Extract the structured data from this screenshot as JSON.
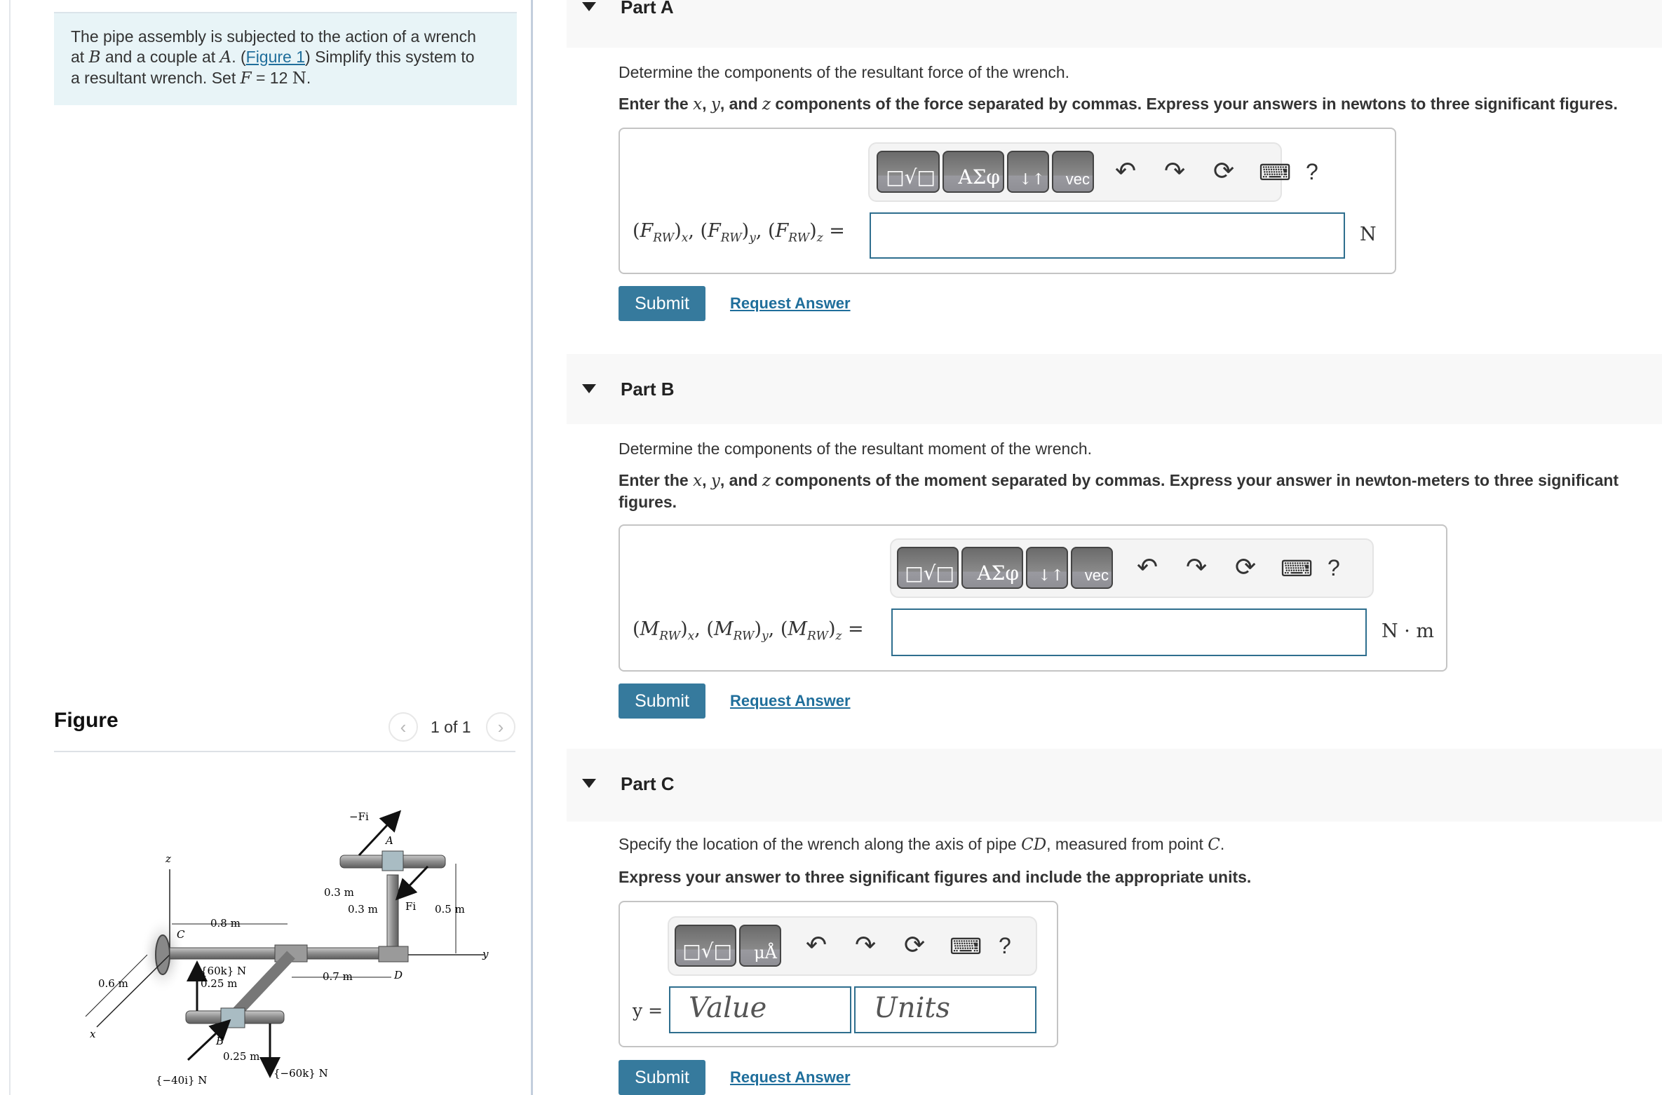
{
  "problem": {
    "text_1": "The pipe assembly is subjected to the action of a wrench",
    "text_2_pre": "at ",
    "var_B": "B",
    "text_2_mid": " and a couple at ",
    "var_A": "A",
    "text_2_post": ". (",
    "figure_link": "Figure 1",
    "text_2_end": ") Simplify this system to",
    "text_3_pre": "a resultant wrench. Set ",
    "var_F": "F",
    "text_3_eq": " = 12 ",
    "unit_N": "N",
    "text_3_end": "."
  },
  "figure": {
    "title": "Figure",
    "pager_text": "1 of 1",
    "prev_icon": "‹",
    "next_icon": "›",
    "labels": {
      "z": "z",
      "x": "x",
      "y": "y",
      "C": "C",
      "A": "A",
      "B": "B",
      "D": "D",
      "neg_Fi": "−Fi",
      "Fi": "Fi",
      "d_0_8": "0.8 m",
      "d_0_7": "0.7 m",
      "d_0_6": "0.6 m",
      "d_0_5": "0.5 m",
      "d_0_3a": "0.3 m",
      "d_0_3b": "0.3 m",
      "d_0_25a": "0.25 m",
      "d_0_25b": "0.25 m",
      "f_60k": "{60k} N",
      "f_neg60k": "{−60k} N",
      "f_neg40i": "{−40i} N"
    }
  },
  "parts": [
    {
      "title": "Part A",
      "prompt": "Determine the components of the resultant force of the wrench.",
      "instruction_pre": "Enter the ",
      "instruction_x": "x",
      "instruction_sep1": ", ",
      "instruction_y": "y",
      "instruction_sep2": ", and ",
      "instruction_z": "z",
      "instruction_post": " components of the force separated by commas. Express your answers in newtons to three significant figures.",
      "label_sym": "F",
      "label_sub": "RW",
      "unit": "N",
      "input_value": "",
      "submit": "Submit",
      "request": "Request Answer"
    },
    {
      "title": "Part B",
      "prompt": "Determine the components of the resultant moment of the wrench.",
      "instruction_pre": "Enter the ",
      "instruction_x": "x",
      "instruction_sep1": ", ",
      "instruction_y": "y",
      "instruction_sep2": ", and ",
      "instruction_z": "z",
      "instruction_post": " components of the moment separated by commas. Express your answer in newton-meters to three significant figures.",
      "label_sym": "M",
      "label_sub": "RW",
      "unit": "N · m",
      "input_value": "",
      "submit": "Submit",
      "request": "Request Answer"
    },
    {
      "title": "Part C",
      "prompt_pre": "Specify the location of the wrench along the axis of pipe ",
      "prompt_var": "CD",
      "prompt_mid": ", measured from point ",
      "prompt_var2": "C",
      "prompt_end": ".",
      "instruction": "Express your answer to three significant figures and include the appropriate units.",
      "label": "y =",
      "value_placeholder": "Value",
      "units_placeholder": "Units",
      "submit": "Submit",
      "request": "Request Answer"
    }
  ],
  "toolbar": {
    "templates": "□√□",
    "greek": "ΑΣφ",
    "arrows": "↓↑",
    "vec": "vec",
    "units_btn": "μÅ",
    "undo": "↶",
    "redo": "↷",
    "reset": "⟳",
    "keyboard": "⌨",
    "help": "?"
  }
}
